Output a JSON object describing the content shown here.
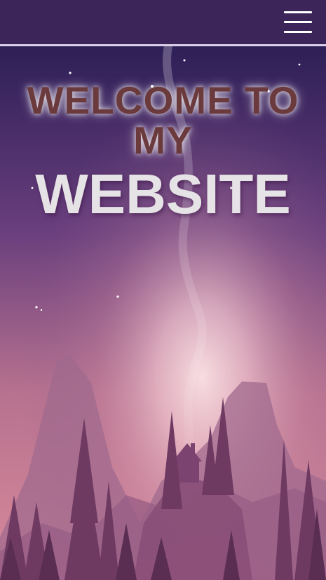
{
  "navbar": {
    "menu_icon": "hamburger-menu-icon",
    "background_color": "#3c2558",
    "border_color": "#d9cfe8"
  },
  "hero": {
    "line1": "WELCOME TO",
    "line2": "MY",
    "line3": "WEBSITE",
    "headline_color": "#6b3a3c",
    "website_color": "#e6e3e6",
    "sky_top_color": "#2e1f57",
    "glow_color": "#f3c9d2"
  }
}
